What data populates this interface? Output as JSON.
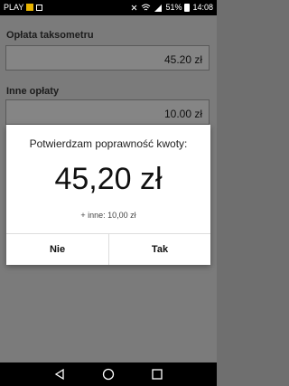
{
  "status_bar": {
    "carrier": "PLAY",
    "battery": "51%",
    "time": "14:08"
  },
  "form": {
    "fare_label": "Opłata taksometru",
    "fare_value": "45.20 zł",
    "other_label": "Inne opłaty",
    "other_value": "10.00 zł"
  },
  "dialog": {
    "title": "Potwierdzam poprawność kwoty:",
    "amount": "45,20 zł",
    "extra": "+ inne: 10,00 zł",
    "no_label": "Nie",
    "yes_label": "Tak"
  },
  "icons": {
    "nav": [
      "back-icon",
      "home-icon",
      "recents-icon"
    ]
  }
}
